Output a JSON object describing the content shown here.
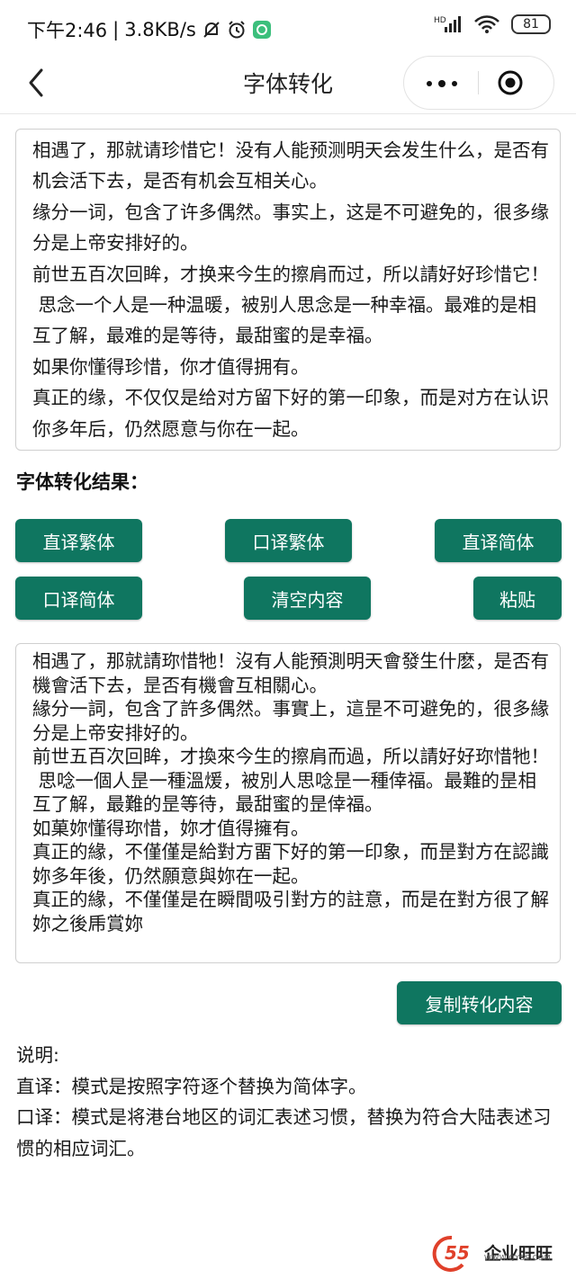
{
  "status_bar": {
    "time": "下午2:46",
    "speed": "3.8KB/s",
    "network": "HD",
    "battery": "81"
  },
  "nav": {
    "title": "字体转化"
  },
  "input_text": {
    "lines": [
      "相遇了，那就请珍惜它！没有人能预测明天会发生什么，是否有机会活下去，是否有机会互相关心。",
      "缘分一词，包含了许多偶然。事实上，这是不可避免的，很多缘分是上帝安排好的。",
      "前世五百次回眸，才换来今生的擦肩而过，所以請好好珍惜它！",
      " 思念一个人是一种温暖，被别人思念是一种幸福。最难的是相互了解，最难的是等待，最甜蜜的是幸福。",
      "如果你懂得珍惜，你才值得拥有。",
      "真正的缘，不仅仅是给对方留下好的第一印象，而是对方在认识你多年后，仍然愿意与你在一起。"
    ]
  },
  "result_label": "字体转化结果：",
  "buttons": {
    "literal_traditional": "直译繁体",
    "oral_traditional": "口译繁体",
    "literal_simplified": "直译简体",
    "oral_simplified": "口译简体",
    "clear": "清空内容",
    "paste": "粘贴",
    "copy": "复制转化内容"
  },
  "output_text": {
    "lines": [
      "相遇了，那就請珎惜牠！沒有人能預測明天會發生什麽，是否有機會活下去，昰否有機會互相關心。",
      "緣分一詞，包含了許多偶然。事實上，這昰不可避免的，很多緣分是上帝安排好的。",
      "前世五百次回眸，才換來今生的擦肩而過，所以請好好珎惜牠！",
      " 思唸一個人昰一種溫煖，被別人思唸昰一種倖福。最難的昰相互了解，最難的昰等待，最甜蜜的昰倖福。",
      "如菓妳懂得珎惜，妳才值得擁有。",
      "真正的緣，不僅僅是給對方畱下好的第一印象，而昰對方在認識妳多年後，仍然願意與妳在一起。",
      "真正的緣，不僅僅是在瞬間吸引對方的註意，而是在對方很了解妳之後乕賞妳"
    ]
  },
  "explanation": {
    "title": "说明:",
    "line1": "直译：模式是按照字符逐个替换为简体字。",
    "line2": "口译：模式是将港台地区的词汇表述习惯，替换为符合大陆表述习惯的相应词汇。"
  },
  "watermark": {
    "logo_number": "55",
    "text": "企业旺旺",
    "url": "WWW.QYSS.COM"
  },
  "colors": {
    "button_green": "#0f7660",
    "watermark_red": "#e0402a"
  }
}
